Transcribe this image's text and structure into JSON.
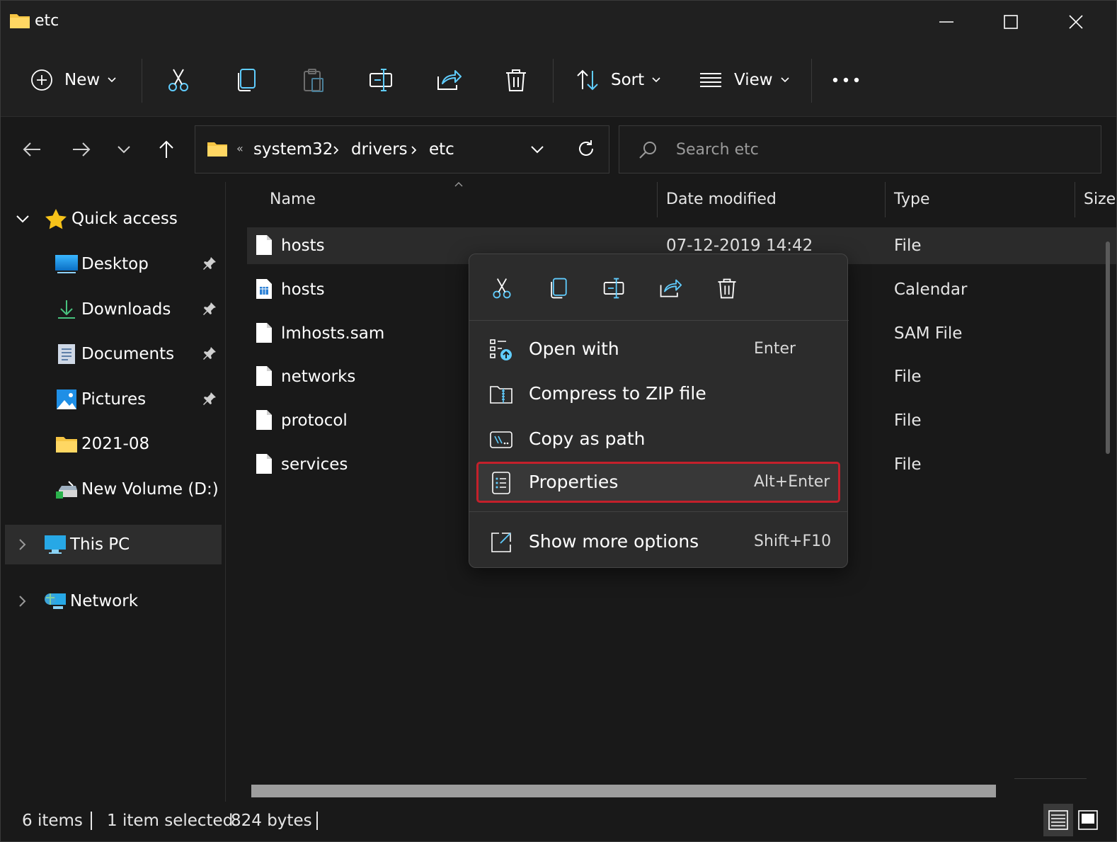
{
  "window": {
    "title": "etc"
  },
  "toolbar": {
    "new_label": "New",
    "sort_label": "Sort",
    "view_label": "View"
  },
  "address": {
    "overflow_glyph": "«",
    "crumbs": [
      "system32",
      "drivers",
      "etc"
    ]
  },
  "search": {
    "placeholder": "Search etc"
  },
  "sidebar": {
    "quick_access": "Quick access",
    "items": [
      {
        "label": "Desktop",
        "pinned": true
      },
      {
        "label": "Downloads",
        "pinned": true
      },
      {
        "label": "Documents",
        "pinned": true
      },
      {
        "label": "Pictures",
        "pinned": true
      },
      {
        "label": "2021-08",
        "pinned": false
      },
      {
        "label": "New Volume (D:)",
        "pinned": false
      }
    ],
    "this_pc": "This PC",
    "network": "Network"
  },
  "columns": {
    "name": "Name",
    "date": "Date modified",
    "type": "Type",
    "size": "Size"
  },
  "files": [
    {
      "name": "hosts",
      "date": "07-12-2019 14:42",
      "type": "File",
      "selected": true
    },
    {
      "name": "hosts",
      "date": "",
      "type": "Calendar",
      "selected": false
    },
    {
      "name": "lmhosts.sam",
      "date": "",
      "type": "SAM File",
      "selected": false
    },
    {
      "name": "networks",
      "date": "",
      "type": "File",
      "selected": false
    },
    {
      "name": "protocol",
      "date": "",
      "type": "File",
      "selected": false
    },
    {
      "name": "services",
      "date": "",
      "type": "File",
      "selected": false
    }
  ],
  "context_menu": {
    "items": [
      {
        "label": "Open with",
        "shortcut": "Enter"
      },
      {
        "label": "Compress to ZIP file",
        "shortcut": ""
      },
      {
        "label": "Copy as path",
        "shortcut": ""
      },
      {
        "label": "Properties",
        "shortcut": "Alt+Enter",
        "highlighted": true
      },
      {
        "label": "Show more options",
        "shortcut": "Shift+F10"
      }
    ]
  },
  "status": {
    "item_count": "6 items",
    "selected": "1 item selected",
    "size": "824 bytes"
  },
  "colors": {
    "accent": "#60cdff",
    "highlight_border": "#c4202b",
    "folder": "#f6c543"
  }
}
